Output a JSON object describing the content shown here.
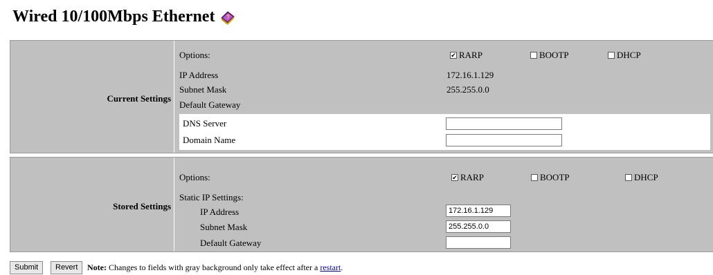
{
  "title": "Wired 10/100Mbps Ethernet",
  "current": {
    "section_label": "Current Settings",
    "options_label": "Options:",
    "options": [
      {
        "label": "RARP",
        "checked": true
      },
      {
        "label": "BOOTP",
        "checked": false
      },
      {
        "label": "DHCP",
        "checked": false
      }
    ],
    "ip_label": "IP Address",
    "ip_value": "172.16.1.129",
    "subnet_label": "Subnet Mask",
    "subnet_value": "255.255.0.0",
    "gateway_label": "Default Gateway",
    "dns_label": "DNS Server",
    "dns_value": "",
    "domain_label": "Domain Name",
    "domain_value": ""
  },
  "stored": {
    "section_label": "Stored Settings",
    "options_label": "Options:",
    "options": [
      {
        "label": "RARP",
        "checked": true
      },
      {
        "label": "BOOTP",
        "checked": false
      },
      {
        "label": "DHCP",
        "checked": false
      }
    ],
    "static_label": "Static IP Settings:",
    "ip_label": "IP Address",
    "ip_value": "172.16.1.129",
    "subnet_label": "Subnet Mask",
    "subnet_value": "255.255.0.0",
    "gateway_label": "Default Gateway",
    "gateway_value": ""
  },
  "buttons": {
    "submit": "Submit",
    "revert": "Revert"
  },
  "note": {
    "prefix": "Note:",
    "text": "Changes to fields with gray background only take effect after a",
    "link": "restart",
    "suffix": "."
  },
  "colors": {
    "panel": "#c0c0c0",
    "link": "#0000cc"
  },
  "icons": {
    "title_icon": "help-book-icon"
  }
}
